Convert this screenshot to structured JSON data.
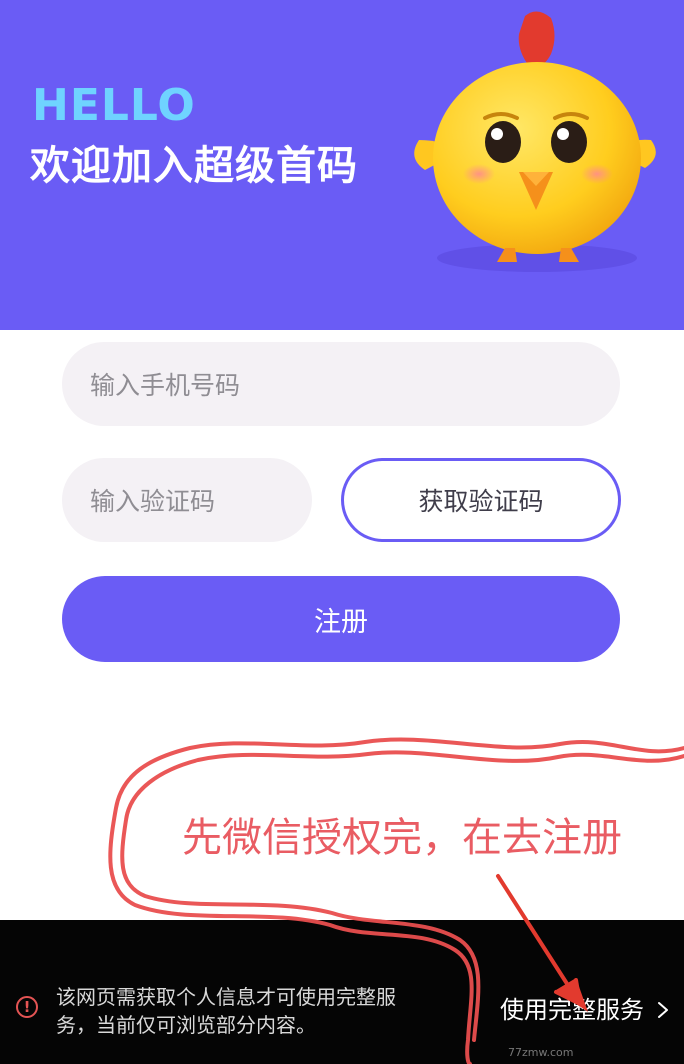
{
  "header": {
    "hello": "HELLO",
    "welcome": "欢迎加入超级首码"
  },
  "form": {
    "phone_placeholder": "输入手机号码",
    "code_placeholder": "输入验证码",
    "get_code_label": "获取验证码",
    "register_label": "注册"
  },
  "annotation": {
    "text": "先微信授权完，在去注册"
  },
  "bottom_bar": {
    "notice": "该网页需获取个人信息才可使用完整服务，当前仅可浏览部分内容。",
    "action_label": "使用完整服务"
  },
  "watermark": "77zmw.com",
  "colors": {
    "brand_purple": "#6a5cf5",
    "hello_blue": "#6fd3ff",
    "annotation_red": "#e95c63",
    "bar_black": "#050505"
  }
}
